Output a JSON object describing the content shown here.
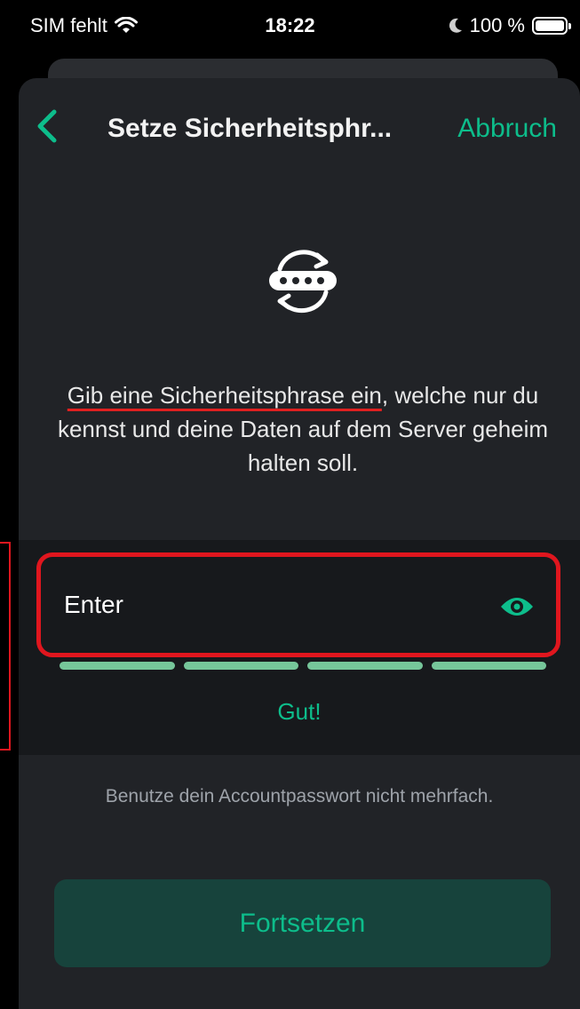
{
  "status_bar": {
    "carrier": "SIM fehlt",
    "time": "18:22",
    "battery": "100 %"
  },
  "nav": {
    "title": "Setze Sicherheitsphr...",
    "cancel_label": "Abbruch"
  },
  "description": {
    "underlined": "Gib eine Sicherheitsphrase ein",
    "rest": ", welche nur du kennst und deine Daten auf dem Server geheim halten soll."
  },
  "passphrase_field": {
    "value": "Enter"
  },
  "strength": {
    "segments_filled": 4,
    "segments_total": 4,
    "label": "Gut!"
  },
  "hint": "Benutze dein Accountpasswort nicht mehrfach.",
  "continue_label": "Fortsetzen",
  "colors": {
    "accent": "#0dbd8b",
    "highlight": "#e0161e",
    "background": "#212327"
  }
}
